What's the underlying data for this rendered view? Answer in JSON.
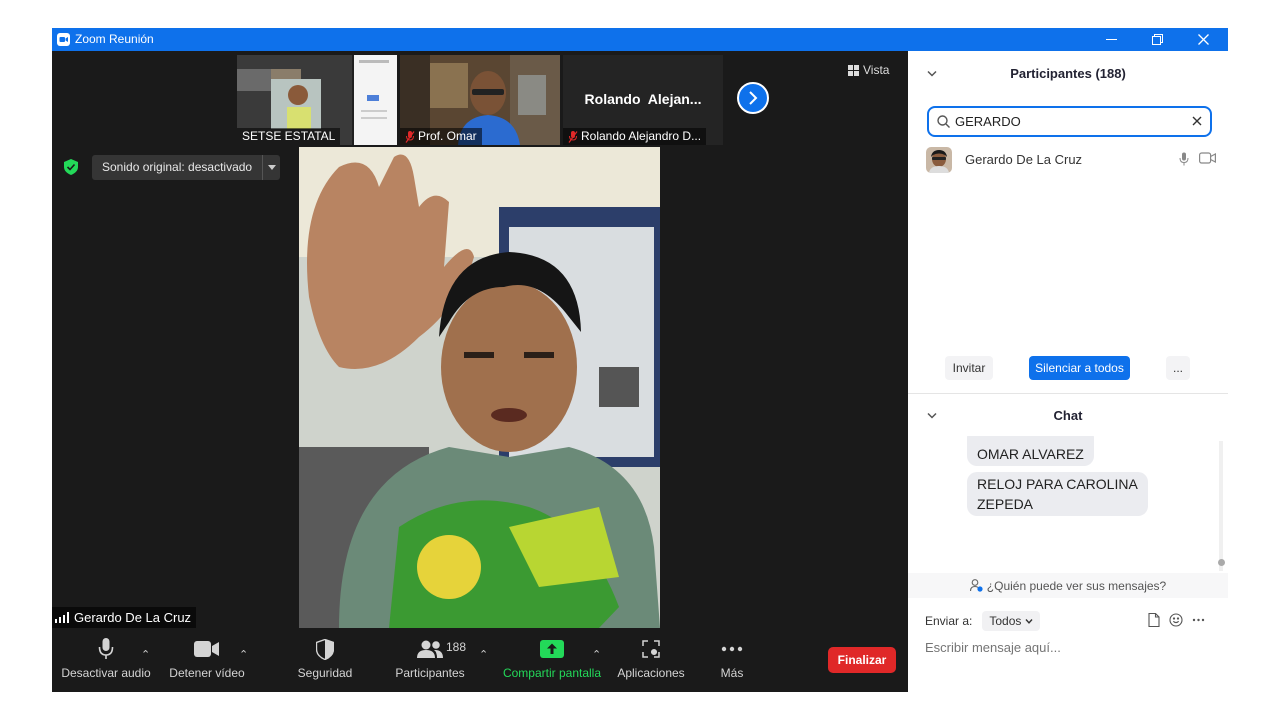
{
  "window": {
    "title": "Zoom Reunión",
    "controls": {
      "minimize": "minimize-icon",
      "restore": "restore-icon",
      "close": "close-icon"
    }
  },
  "thumbnails": [
    {
      "label": "SETSE ESTATAL",
      "muted": false
    },
    {
      "label": "Prof. Omar",
      "muted": true
    },
    {
      "label": "Rolando Alejandro D...",
      "heading": "Rolando  Alejan...",
      "muted": true
    }
  ],
  "view": {
    "label": "Vista"
  },
  "sound": {
    "label": "Sonido original: desactivado"
  },
  "speaker": {
    "name": "Gerardo De La Cruz"
  },
  "toolbar": {
    "audio": "Desactivar audio",
    "video": "Detener vídeo",
    "security": "Seguridad",
    "participants": "Participantes",
    "participants_count": "188",
    "share": "Compartir pantalla",
    "apps": "Aplicaciones",
    "more": "Más",
    "end": "Finalizar"
  },
  "participants_panel": {
    "title": "Participantes (188)",
    "search_value": "GERARDO",
    "results": [
      {
        "name": "Gerardo De La Cruz"
      }
    ],
    "buttons": {
      "invite": "Invitar",
      "mute_all": "Silenciar a todos",
      "more": "..."
    }
  },
  "chat": {
    "title": "Chat",
    "partial_message": "OMAR ALVAREZ",
    "messages": [
      {
        "line1": "RELOJ PARA CAROLINA",
        "line2": "ZEPEDA"
      }
    ],
    "who_can_see": "¿Quién puede ver sus mensajes?",
    "send_to_label": "Enviar a:",
    "send_to_value": "Todos",
    "input_placeholder": "Escribir mensaje aquí..."
  },
  "colors": {
    "zoom_blue": "#0e71eb",
    "end_red": "#e02828",
    "share_green": "#23d959",
    "muted_red": "#e02828"
  }
}
